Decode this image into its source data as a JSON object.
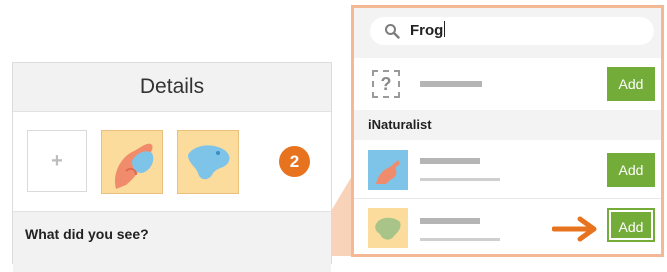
{
  "details_panel": {
    "title": "Details",
    "add_photo_glyph": "+",
    "step_badge": "2",
    "what_did_you_see": "What did you see?"
  },
  "search": {
    "value": "Frog",
    "icon": "search-icon"
  },
  "results": {
    "unknown_icon_glyph": "?",
    "group_label": "iNaturalist",
    "add_label": "Add"
  },
  "colors": {
    "accent_green": "#74ac3a",
    "callout_orange": "#e8731f",
    "thumbnail_yellow": "#fcdc9c",
    "thumbnail_blue": "#7ec4e9"
  }
}
